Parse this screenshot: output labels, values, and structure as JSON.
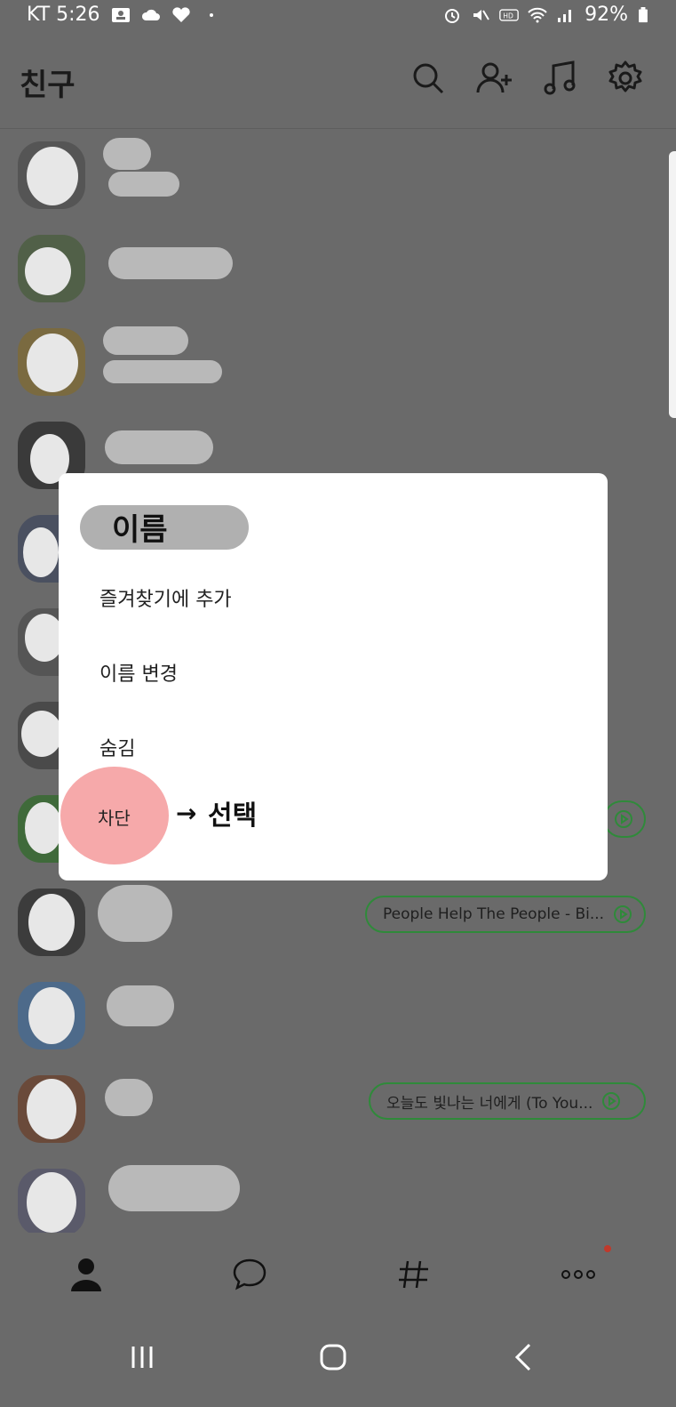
{
  "status": {
    "carrier_time": "KT 5:26",
    "battery": "92%"
  },
  "header": {
    "title": "친구"
  },
  "music": [
    {
      "title": "People Help The People - Bi..."
    },
    {
      "title": "오늘도 빛나는 너에게 (To You..."
    }
  ],
  "dialog": {
    "name": "이름",
    "items": [
      "즐겨찾기에 추가",
      "이름 변경",
      "숨김"
    ],
    "block": "차단",
    "arrow": "→",
    "note": "선택"
  },
  "colors": {
    "overlay": "#6a6a6a",
    "accent_green": "#2f8a3a",
    "highlight_pink": "#f6a9aa"
  }
}
